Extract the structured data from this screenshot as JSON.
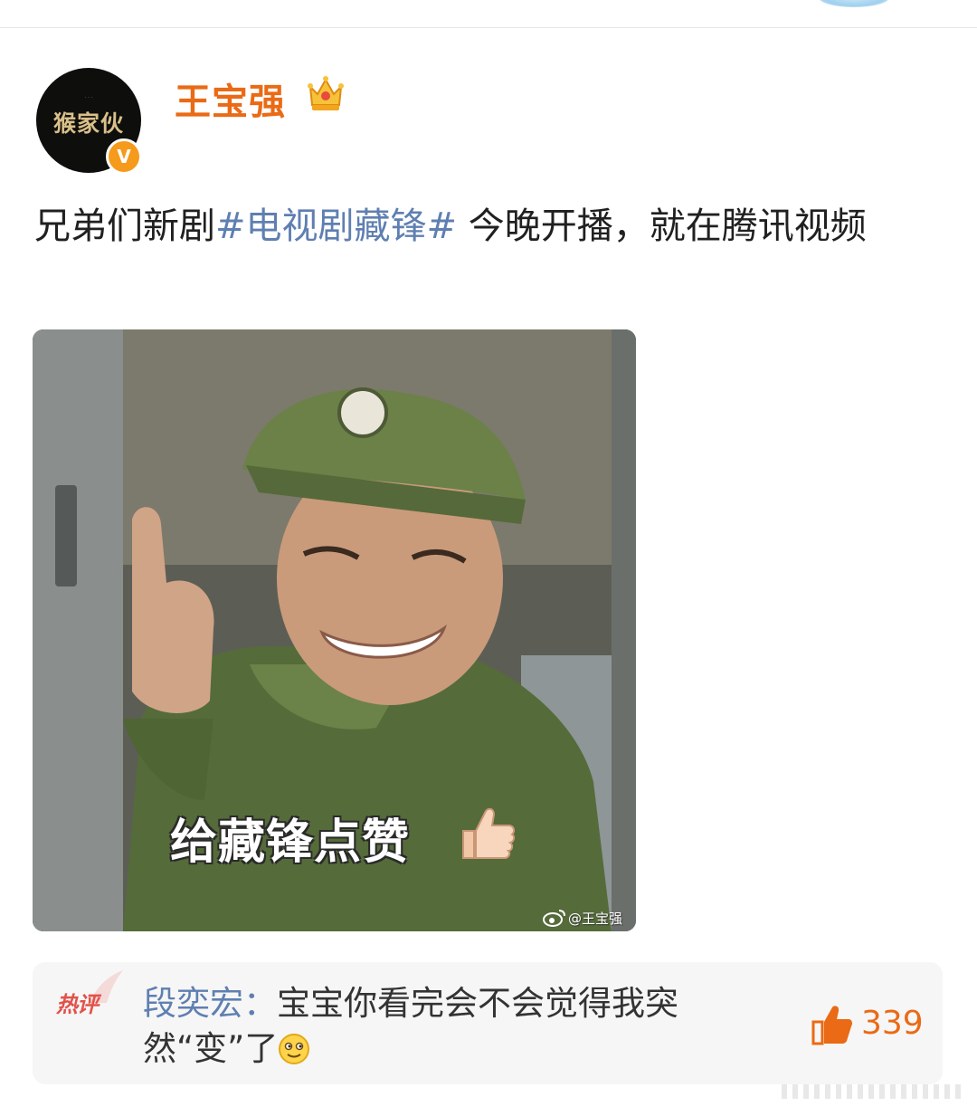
{
  "post": {
    "author": "王宝强",
    "avatar_text": "猴家伙",
    "verified_badge": "V",
    "text_before": "兄弟们新剧",
    "topic": "#电视剧藏锋#",
    "text_after": " 今晚开播，就在腾讯视频",
    "image": {
      "caption": "给藏锋点赞",
      "watermark": "@王宝强"
    }
  },
  "hot_comment": {
    "badge": "热评",
    "author": "段奕宏",
    "separator": "：",
    "text": "宝宝你看完会不会觉得我突然“变”了",
    "likes": "339"
  },
  "colors": {
    "username": "#ea6a15",
    "topic": "#5f7fb1",
    "hot_badge": "#e2524a",
    "comment_bg": "#f6f6f6",
    "verified": "#f59a1b"
  },
  "icons": [
    "crown-icon",
    "verified-icon",
    "thumbs-up-emoji-icon",
    "weibo-icon",
    "hot-comment-icon",
    "smiley-emoji-icon",
    "like-icon"
  ]
}
